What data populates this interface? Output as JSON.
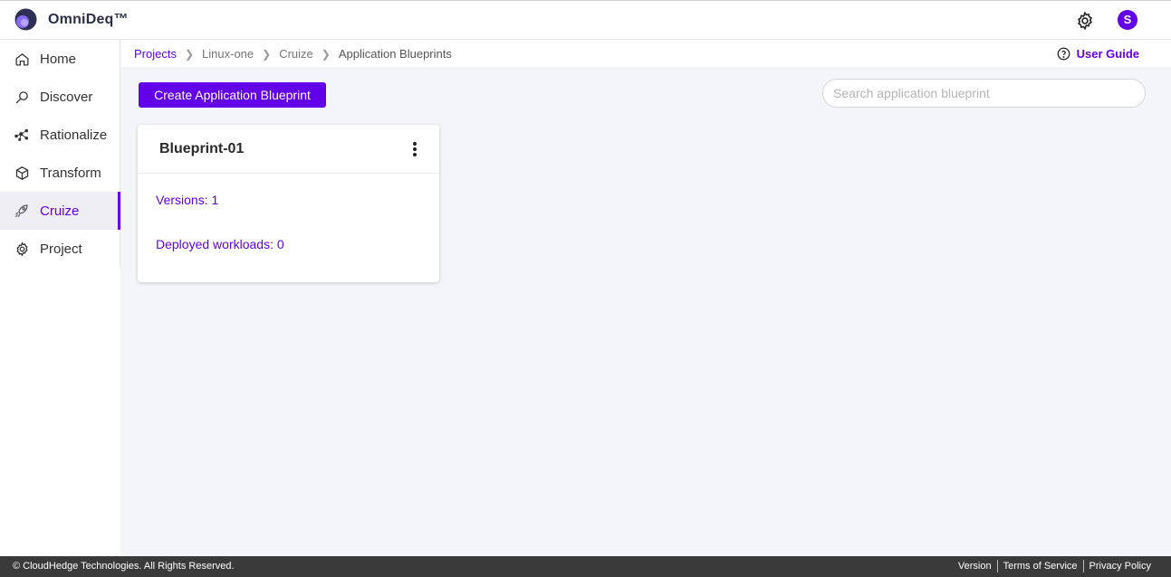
{
  "header": {
    "app_title": "OmniDeq™",
    "avatar_initial": "S",
    "accent_color": "#6200ea"
  },
  "sidebar": {
    "items": [
      {
        "label": "Home",
        "icon": "home-icon"
      },
      {
        "label": "Discover",
        "icon": "search-icon"
      },
      {
        "label": "Rationalize",
        "icon": "network-icon"
      },
      {
        "label": "Transform",
        "icon": "cube-icon"
      },
      {
        "label": "Cruize",
        "icon": "rocket-icon",
        "active": true
      },
      {
        "label": "Project",
        "icon": "gear-icon"
      }
    ]
  },
  "breadcrumb": {
    "items": [
      "Projects",
      "Linux-one",
      "Cruize",
      "Application Blueprints"
    ]
  },
  "user_guide": {
    "label": "User Guide",
    "icon": "help-circle-icon"
  },
  "toolbar": {
    "create_label": "Create Application Blueprint",
    "search_placeholder": "Search application blueprint",
    "search_value": ""
  },
  "card": {
    "title": "Blueprint-01",
    "versions": "Versions: 1",
    "deployed": "Deployed workloads: 0",
    "menu_icon": "more-vertical-icon"
  },
  "footer": {
    "copyright": "© CloudHedge Technologies. All Rights Reserved.",
    "links": [
      "Version",
      "Terms of Service",
      "Privacy Policy"
    ]
  }
}
